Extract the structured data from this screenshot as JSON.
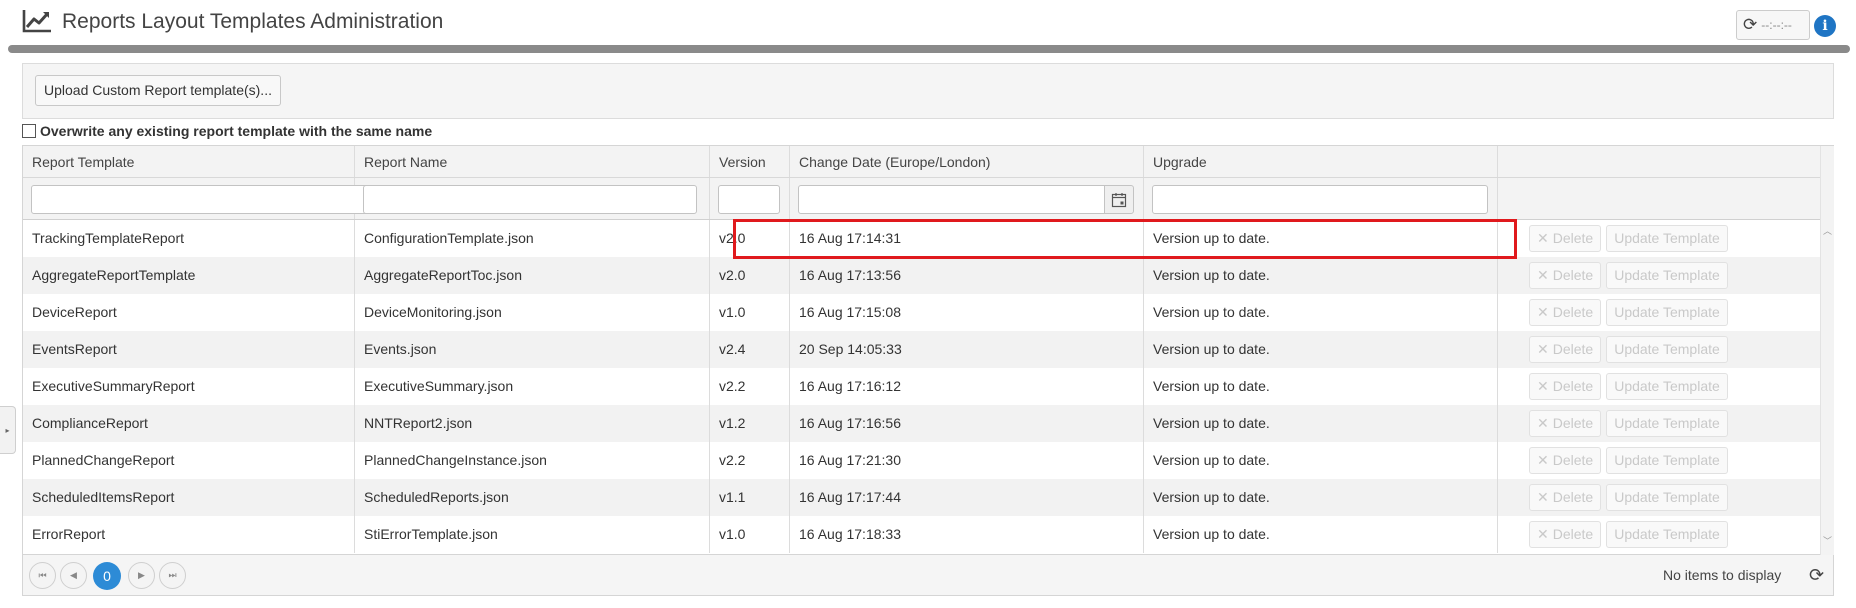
{
  "header": {
    "title": "Reports Layout Templates Administration",
    "refresh_text": "--:--:--",
    "info_label": "i"
  },
  "toolbar": {
    "upload_label": "Upload Custom Report template(s)..."
  },
  "overwrite": {
    "label": "Overwrite any existing report template with the same name",
    "checked": false
  },
  "grid": {
    "columns": [
      "Report Template",
      "Report Name",
      "Version",
      "Change Date (Europe/London)",
      "Upgrade",
      ""
    ],
    "rows": [
      {
        "template": "TrackingTemplateReport",
        "name": "ConfigurationTemplate.json",
        "version": "v2.0",
        "date": "16 Aug 17:14:31",
        "upgrade": "Version up to date."
      },
      {
        "template": "AggregateReportTemplate",
        "name": "AggregateReportToc.json",
        "version": "v2.0",
        "date": "16 Aug 17:13:56",
        "upgrade": "Version up to date."
      },
      {
        "template": "DeviceReport",
        "name": "DeviceMonitoring.json",
        "version": "v1.0",
        "date": "16 Aug 17:15:08",
        "upgrade": "Version up to date."
      },
      {
        "template": "EventsReport",
        "name": "Events.json",
        "version": "v2.4",
        "date": "20 Sep 14:05:33",
        "upgrade": "Version up to date."
      },
      {
        "template": "ExecutiveSummaryReport",
        "name": "ExecutiveSummary.json",
        "version": "v2.2",
        "date": "16 Aug 17:16:12",
        "upgrade": "Version up to date."
      },
      {
        "template": "ComplianceReport",
        "name": "NNTReport2.json",
        "version": "v1.2",
        "date": "16 Aug 17:16:56",
        "upgrade": "Version up to date."
      },
      {
        "template": "PlannedChangeReport",
        "name": "PlannedChangeInstance.json",
        "version": "v2.2",
        "date": "16 Aug 17:21:30",
        "upgrade": "Version up to date."
      },
      {
        "template": "ScheduledItemsReport",
        "name": "ScheduledReports.json",
        "version": "v1.1",
        "date": "16 Aug 17:17:44",
        "upgrade": "Version up to date."
      },
      {
        "template": "ErrorReport",
        "name": "StiErrorTemplate.json",
        "version": "v1.0",
        "date": "16 Aug 17:18:33",
        "upgrade": "Version up to date."
      }
    ],
    "delete_label": "Delete",
    "update_label": "Update Template"
  },
  "pager": {
    "current_page": "0",
    "items_text": "No items to display"
  },
  "colors": {
    "accent": "#2d8bd6",
    "highlight": "#e0191d",
    "info": "#1f75c4"
  }
}
